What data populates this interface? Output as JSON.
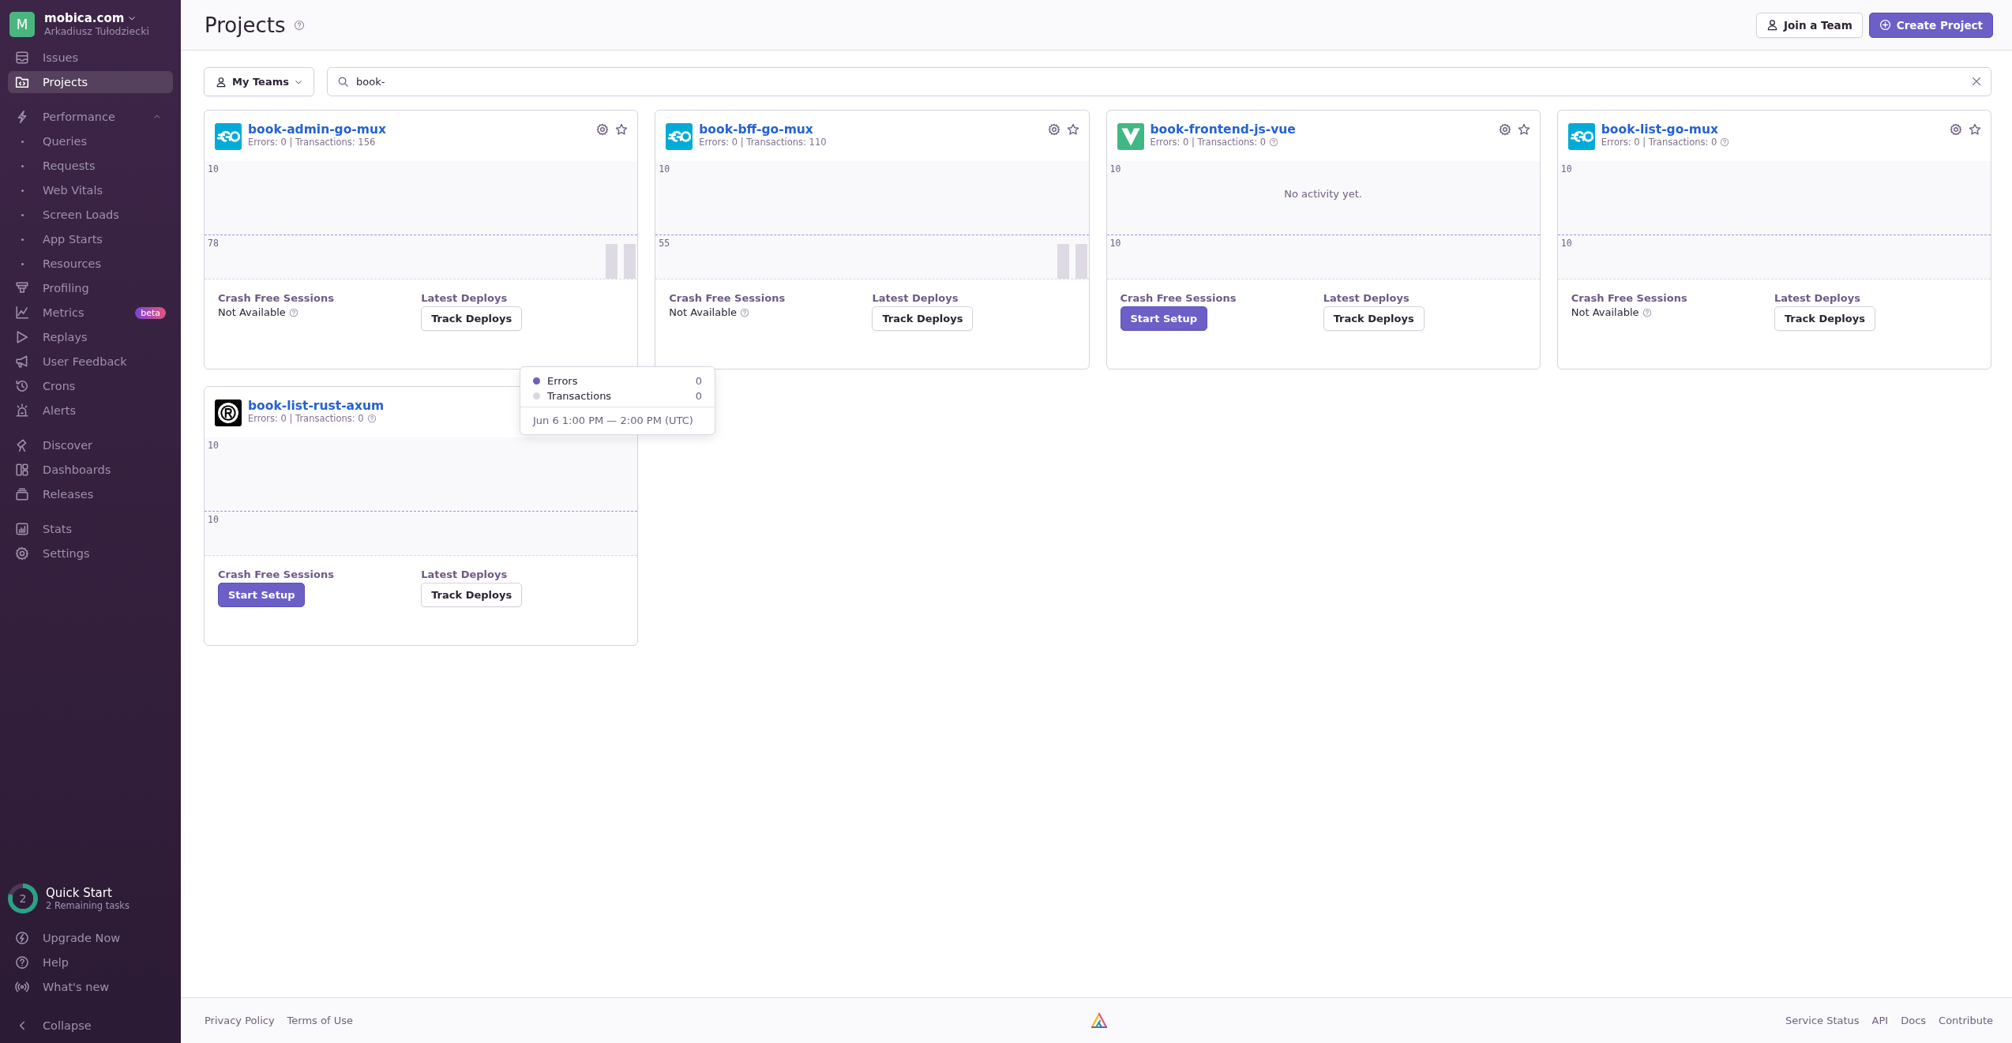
{
  "org": {
    "avatar": "M",
    "name": "mobica.com",
    "user": "Arkadiusz Tułodziecki"
  },
  "sidebar": {
    "sections": [
      {
        "items": [
          {
            "label": "Issues",
            "kind": "item",
            "selected": false
          },
          {
            "label": "Projects",
            "kind": "item",
            "selected": true
          }
        ]
      },
      {
        "items": [
          {
            "label": "Performance",
            "kind": "group",
            "selected": false,
            "expanded": true
          },
          {
            "label": "Queries",
            "kind": "sub",
            "selected": false
          },
          {
            "label": "Requests",
            "kind": "sub",
            "selected": false
          },
          {
            "label": "Web Vitals",
            "kind": "sub",
            "selected": false
          },
          {
            "label": "Screen Loads",
            "kind": "sub",
            "selected": false
          },
          {
            "label": "App Starts",
            "kind": "sub",
            "selected": false
          },
          {
            "label": "Resources",
            "kind": "sub",
            "selected": false
          },
          {
            "label": "Profiling",
            "kind": "item",
            "selected": false
          },
          {
            "label": "Metrics",
            "kind": "item",
            "selected": false,
            "badge": "beta"
          },
          {
            "label": "Replays",
            "kind": "item",
            "selected": false
          },
          {
            "label": "User Feedback",
            "kind": "item",
            "selected": false
          },
          {
            "label": "Crons",
            "kind": "item",
            "selected": false
          },
          {
            "label": "Alerts",
            "kind": "item",
            "selected": false
          }
        ]
      },
      {
        "items": [
          {
            "label": "Discover",
            "kind": "item",
            "selected": false
          },
          {
            "label": "Dashboards",
            "kind": "item",
            "selected": false
          },
          {
            "label": "Releases",
            "kind": "item",
            "selected": false
          }
        ]
      },
      {
        "items": [
          {
            "label": "Stats",
            "kind": "item",
            "selected": false
          },
          {
            "label": "Settings",
            "kind": "item",
            "selected": false
          }
        ]
      }
    ],
    "quick_start": {
      "count": "2",
      "title": "Quick Start",
      "subtitle": "2 Remaining tasks"
    },
    "bottom_items": [
      {
        "label": "Upgrade Now"
      },
      {
        "label": "Help"
      },
      {
        "label": "What's new"
      }
    ],
    "collapse": {
      "label": "Collapse"
    }
  },
  "header": {
    "title": "Projects",
    "buttons": [
      {
        "label": "Join a Team",
        "kind": "secondary"
      },
      {
        "label": "Create Project",
        "kind": "primary"
      }
    ]
  },
  "filters": {
    "team_dropdown": "My Teams",
    "search": {
      "value": "book-"
    }
  },
  "projects": [
    {
      "name": "book-admin-go-mux",
      "avatar": {
        "kind": "go"
      },
      "stats": "Errors: 0 | Transactions: 156",
      "help_icon": false,
      "top_label": "10",
      "bottom_label": "78",
      "recent_bars": true,
      "crash_label": "Crash Free Sessions",
      "crash": {
        "kind": "value"
      },
      "crash_value": "Not Available",
      "deploys_label": "Latest Deploys",
      "deploys_button": "Track Deploys"
    },
    {
      "name": "book-bff-go-mux",
      "avatar": {
        "kind": "go"
      },
      "stats": "Errors: 0 | Transactions: 110",
      "help_icon": false,
      "top_label": "10",
      "bottom_label": "55",
      "recent_bars": true,
      "crash_label": "Crash Free Sessions",
      "crash": {
        "kind": "value"
      },
      "crash_value": "Not Available",
      "deploys_label": "Latest Deploys",
      "deploys_button": "Track Deploys"
    },
    {
      "name": "book-frontend-js-vue",
      "avatar": {
        "kind": "vue"
      },
      "stats": "Errors: 0 | Transactions: 0",
      "help_icon": true,
      "top_label": "10",
      "bottom_label": "10",
      "recent_bars": false,
      "empty_message": "No activity yet.",
      "crash_label": "Crash Free Sessions",
      "crash": {
        "kind": "action"
      },
      "crash_value": "Start Setup",
      "deploys_label": "Latest Deploys",
      "deploys_button": "Track Deploys"
    },
    {
      "name": "book-list-go-mux",
      "avatar": {
        "kind": "go"
      },
      "stats": "Errors: 0 | Transactions: 0",
      "help_icon": true,
      "top_label": "10",
      "bottom_label": "10",
      "recent_bars": false,
      "crash_label": "Crash Free Sessions",
      "crash": {
        "kind": "value"
      },
      "crash_value": "Not Available",
      "deploys_label": "Latest Deploys",
      "deploys_button": "Track Deploys"
    },
    {
      "name": "book-list-rust-axum",
      "avatar": {
        "kind": "rust"
      },
      "actions_covered": true,
      "stats": "Errors: 0 | Transactions: 0",
      "help_icon": true,
      "top_label": "10",
      "bottom_label": "10",
      "recent_bars": false,
      "crash_label": "Crash Free Sessions",
      "crash": {
        "kind": "action"
      },
      "crash_value": "Start Setup",
      "deploys_label": "Latest Deploys",
      "deploys_button": "Track Deploys"
    }
  ],
  "tooltip": {
    "series": [
      {
        "name": "Errors",
        "value": "0",
        "color": "#6c5fc7"
      },
      {
        "name": "Transactions",
        "value": "0",
        "color": "#dbd6e1"
      }
    ],
    "time": "Jun 6 1:00 PM — 2:00 PM (UTC)"
  },
  "footer": {
    "left_links": [
      "Privacy Policy",
      "Terms of Use"
    ],
    "right_links": [
      "Service Status",
      "API",
      "Docs",
      "Contribute"
    ]
  }
}
